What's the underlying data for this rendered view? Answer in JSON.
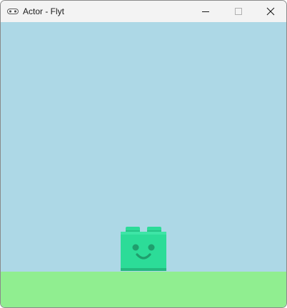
{
  "window": {
    "title": "Actor - Flyt",
    "app_icon": "controller-icon",
    "controls": {
      "minimize_icon": "minimize-icon",
      "maximize_icon": "maximize-icon",
      "close_icon": "close-icon"
    }
  },
  "scene": {
    "sky_color": "#add8e6",
    "ground_color": "#90ee90",
    "actor": {
      "name": "actor-block",
      "body_color": "#2cdc98",
      "face_color": "#1f9e6d"
    }
  }
}
